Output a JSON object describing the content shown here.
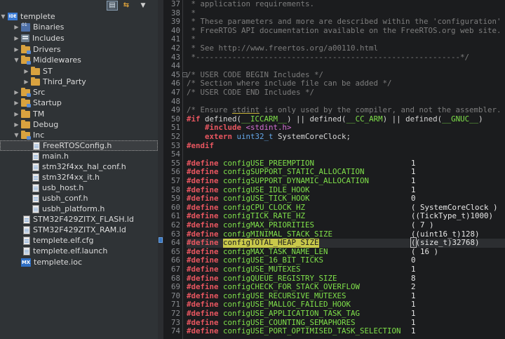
{
  "explorer": {
    "toolbar": {
      "collapse_icon": "collapse-all-icon",
      "link_icon": "link-with-editor-icon",
      "menu_icon": "view-menu-icon"
    },
    "items": [
      {
        "label": "templete",
        "icon": "ide-project-icon",
        "expanded": true
      },
      {
        "label": "Binaries",
        "icon": "binaries-icon",
        "expanded": false
      },
      {
        "label": "Includes",
        "icon": "includes-icon",
        "expanded": false
      },
      {
        "label": "Drivers",
        "icon": "source-folder-icon",
        "expanded": false
      },
      {
        "label": "Middlewares",
        "icon": "source-folder-icon",
        "expanded": true
      },
      {
        "label": "ST",
        "icon": "folder-icon",
        "expanded": false
      },
      {
        "label": "Third_Party",
        "icon": "folder-icon",
        "expanded": false
      },
      {
        "label": "Src",
        "icon": "source-folder-icon",
        "expanded": false
      },
      {
        "label": "Startup",
        "icon": "source-folder-icon",
        "expanded": false
      },
      {
        "label": "TM",
        "icon": "folder-icon",
        "expanded": false
      },
      {
        "label": "Debug",
        "icon": "folder-icon",
        "expanded": false
      },
      {
        "label": "Inc",
        "icon": "source-folder-icon",
        "expanded": true
      },
      {
        "label": "FreeRTOSConfig.h",
        "icon": "header-file-icon",
        "selected": true
      },
      {
        "label": "main.h",
        "icon": "header-file-icon"
      },
      {
        "label": "stm32f4xx_hal_conf.h",
        "icon": "header-file-icon"
      },
      {
        "label": "stm32f4xx_it.h",
        "icon": "header-file-icon"
      },
      {
        "label": "usb_host.h",
        "icon": "header-file-icon"
      },
      {
        "label": "usbh_conf.h",
        "icon": "header-file-icon"
      },
      {
        "label": "usbh_platform.h",
        "icon": "header-file-icon"
      },
      {
        "label": "STM32F429ZITX_FLASH.ld",
        "icon": "linker-file-icon"
      },
      {
        "label": "STM32F429ZITX_RAM.ld",
        "icon": "linker-file-icon"
      },
      {
        "label": "templete.elf.cfg",
        "icon": "config-file-icon"
      },
      {
        "label": "templete.elf.launch",
        "icon": "launch-file-icon"
      },
      {
        "label": "templete.ioc",
        "icon": "mx-ioc-icon"
      }
    ]
  },
  "editor": {
    "line_numbers": [
      "37",
      "38",
      "39",
      "40",
      "41",
      "42",
      "43",
      "44",
      "45",
      "46",
      "47",
      "48",
      "49",
      "50",
      "51",
      "52",
      "53",
      "54",
      "55",
      "56",
      "57",
      "58",
      "59",
      "60",
      "61",
      "62",
      "63",
      "64",
      "65",
      "66",
      "67",
      "68",
      "69",
      "70",
      "71",
      "72",
      "73",
      "74"
    ],
    "lines": {
      "l37": " * application requirements.",
      "l38": " *",
      "l39": " * These parameters and more are described within the 'configuration' s",
      "l40": " * FreeRTOS API documentation available on the FreeRTOS.org web site.",
      "l41": " *",
      "l42": " * See http://www.freertos.org/a00110.html",
      "l43": " *----------------------------------------------------------*/",
      "l44": "",
      "l45": "/* USER CODE BEGIN Includes */",
      "l46": "/* Section where include file can be added */",
      "l47": "/* USER CODE END Includes */",
      "l48": "",
      "l49_a": "/* Ensure ",
      "l49_b": "stdint",
      "l49_c": " is only used by the compiler, and not the assembler. */",
      "l50_if": "#if",
      "l50_a": " defined(",
      "l50_m1": "__ICCARM__",
      "l50_b": ") || defined(",
      "l50_m2": "__CC_ARM",
      "l50_c": ") || defined(",
      "l50_m3": "__GNUC__",
      "l50_d": ")",
      "l51_inc": "#include",
      "l51_file": " <stdint.h>",
      "l52_ext": "extern",
      "l52_typ": " uint32_t",
      "l52_rest": " SystemCoreClock;",
      "l53": "#endif",
      "define_kw": "#define"
    },
    "defines": [
      {
        "line": "55",
        "name": "configUSE_PREEMPTION",
        "value": "1"
      },
      {
        "line": "56",
        "name": "configSUPPORT_STATIC_ALLOCATION",
        "value": "1"
      },
      {
        "line": "57",
        "name": "configSUPPORT_DYNAMIC_ALLOCATION",
        "value": "1"
      },
      {
        "line": "58",
        "name": "configUSE_IDLE_HOOK",
        "value": "1"
      },
      {
        "line": "59",
        "name": "configUSE_TICK_HOOK",
        "value": "0"
      },
      {
        "line": "60",
        "name": "configCPU_CLOCK_HZ",
        "value": "( SystemCoreClock )"
      },
      {
        "line": "61",
        "name": "configTICK_RATE_HZ",
        "value": "((TickType_t)1000)"
      },
      {
        "line": "62",
        "name": "configMAX_PRIORITIES",
        "value": "( 7 )"
      },
      {
        "line": "63",
        "name": "configMINIMAL_STACK_SIZE",
        "value": "((uint16_t)128)"
      },
      {
        "line": "64",
        "name": "configTOTAL_HEAP_SIZE",
        "value": "((size_t)32768)",
        "highlighted": true
      },
      {
        "line": "65",
        "name": "configMAX_TASK_NAME_LEN",
        "value": "( 16 )"
      },
      {
        "line": "66",
        "name": "configUSE_16_BIT_TICKS",
        "value": "0"
      },
      {
        "line": "67",
        "name": "configUSE_MUTEXES",
        "value": "1"
      },
      {
        "line": "68",
        "name": "configQUEUE_REGISTRY_SIZE",
        "value": "8"
      },
      {
        "line": "69",
        "name": "configCHECK_FOR_STACK_OVERFLOW",
        "value": "2"
      },
      {
        "line": "70",
        "name": "configUSE_RECURSIVE_MUTEXES",
        "value": "1"
      },
      {
        "line": "71",
        "name": "configUSE_MALLOC_FAILED_HOOK",
        "value": "1"
      },
      {
        "line": "72",
        "name": "configUSE_APPLICATION_TASK_TAG",
        "value": "1"
      },
      {
        "line": "73",
        "name": "configUSE_COUNTING_SEMAPHORES",
        "value": "1"
      },
      {
        "line": "74",
        "name": "configUSE_PORT_OPTIMISED_TASK_SELECTION",
        "value": "1"
      }
    ]
  },
  "colors": {
    "comment": "#7d7d7d",
    "directive": "#e85660",
    "macro": "#7fe04a",
    "type": "#65a7e8",
    "include_path": "#d46fd4",
    "selection_highlight": "#c8c84a"
  }
}
